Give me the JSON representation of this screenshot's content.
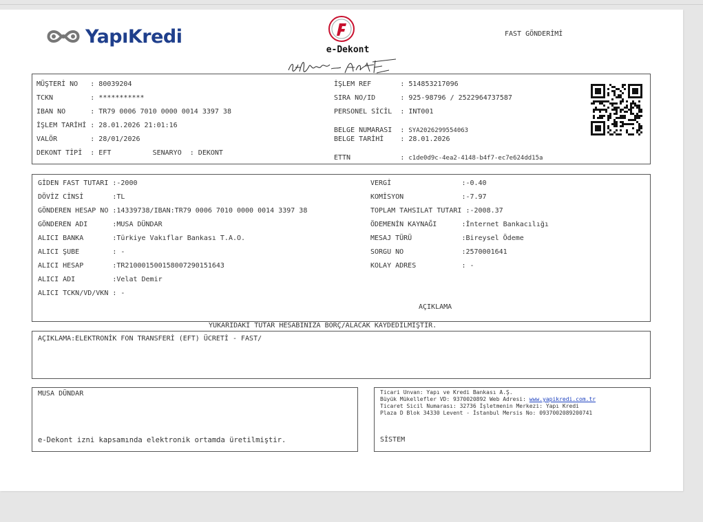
{
  "header": {
    "bank_name": "YapıKredi",
    "document_title": "e-Dekont",
    "transaction_title": "FAST GÖNDERİMİ"
  },
  "info": {
    "musteri_no": "MÜŞTERİ NO   : 80039204",
    "tckn": "TCKN         : ***********",
    "iban": "IBAN NO      : TR79 0006 7010 0000 0014 3397 38",
    "islem_tarihi": "İŞLEM TARİHİ : 28.01.2026 21:01:16",
    "valor": "VALÖR        : 28/01/2026",
    "dekont_tipi": "DEKONT TİPİ  : EFT          SENARYO  : DEKONT",
    "islem_ref": "İŞLEM REF       : 514853217096",
    "sira_no": "SIRA NO/ID      : 925-98796 / 2522964737587",
    "personel_sicil": "PERSONEL SİCİL  : INT001",
    "belge_numarasi_label": "BELGE NUMARASI  : ",
    "belge_numarasi_value": "SYA2026299554063",
    "belge_tarihi": "BELGE TARİHİ    : 28.01.2026",
    "ettn_label": "ETTN            : ",
    "ettn_value": "c1de0d9c-4ea2-4148-b4f7-ec7e624dd15a"
  },
  "transfer_left": [
    "GİDEN FAST TUTARI :-2000",
    "DÖVİZ CİNSİ       :TL",
    "GÖNDEREN HESAP NO :14339738/IBAN:TR79 0006 7010 0000 0014 3397 38",
    "GÖNDEREN ADI      :MUSA DÜNDAR",
    "ALICI BANKA       :Türkiye Vakıflar Bankası T.A.O.",
    "ALICI ŞUBE        : -",
    "ALICI HESAP       :TR210001500158007290151643",
    "ALICI ADI         :Velat Demir",
    "ALICI TCKN/VD/VKN : -"
  ],
  "transfer_right": [
    "VERGİ                 :-0.40",
    "KOMİSYON              :-7.97",
    "TOPLAM TAHSILAT TUTARI :-2008.37",
    "ÖDEMENİN KAYNAĞI      :İnternet Bankacılığı",
    "MESAJ TÜRÜ            :Bireysel Ödeme",
    "SORGU NO              :2570001641",
    "KOLAY ADRES           : -"
  ],
  "aciklama_heading": "AÇIKLAMA",
  "summary_line": "YUKARIDAKİ TUTAR HESABINIZA BORÇ/ALACAK KAYDEDİLMİŞTİR.",
  "description": "AÇIKLAMA:ELEKTRONİK FON TRANSFERİ (EFT) ÜCRETİ - FAST/",
  "footer": {
    "customer_name": "MUSA DÜNDAR",
    "edekont_note": "e-Dekont izni kapsamında elektronik ortamda üretilmiştir.",
    "bank_line1": "Ticari Unvan: Yapı ve Kredi Bankası A.Ş.",
    "bank_line2_prefix": "Büyük Mükellefler VD: 9370020892 Web Adresi: ",
    "bank_website": "www.yapikredi.com.tr",
    "bank_line3": "Ticaret Sicil Numarası: 32736 İşletmenin Merkezi: Yapı Kredi",
    "bank_line4": "Plaza D Blok 34330 Levent - İstanbul Mersis No: 0937002089200741",
    "system_label": "SİSTEM"
  },
  "colors": {
    "brand_blue": "#1f3f8c",
    "emblem_red": "#c8102e",
    "border": "#555555"
  },
  "icons": [
    "yapikredi-logo-icon",
    "bank-emblem-icon",
    "signature-icon",
    "qr-code-icon"
  ]
}
